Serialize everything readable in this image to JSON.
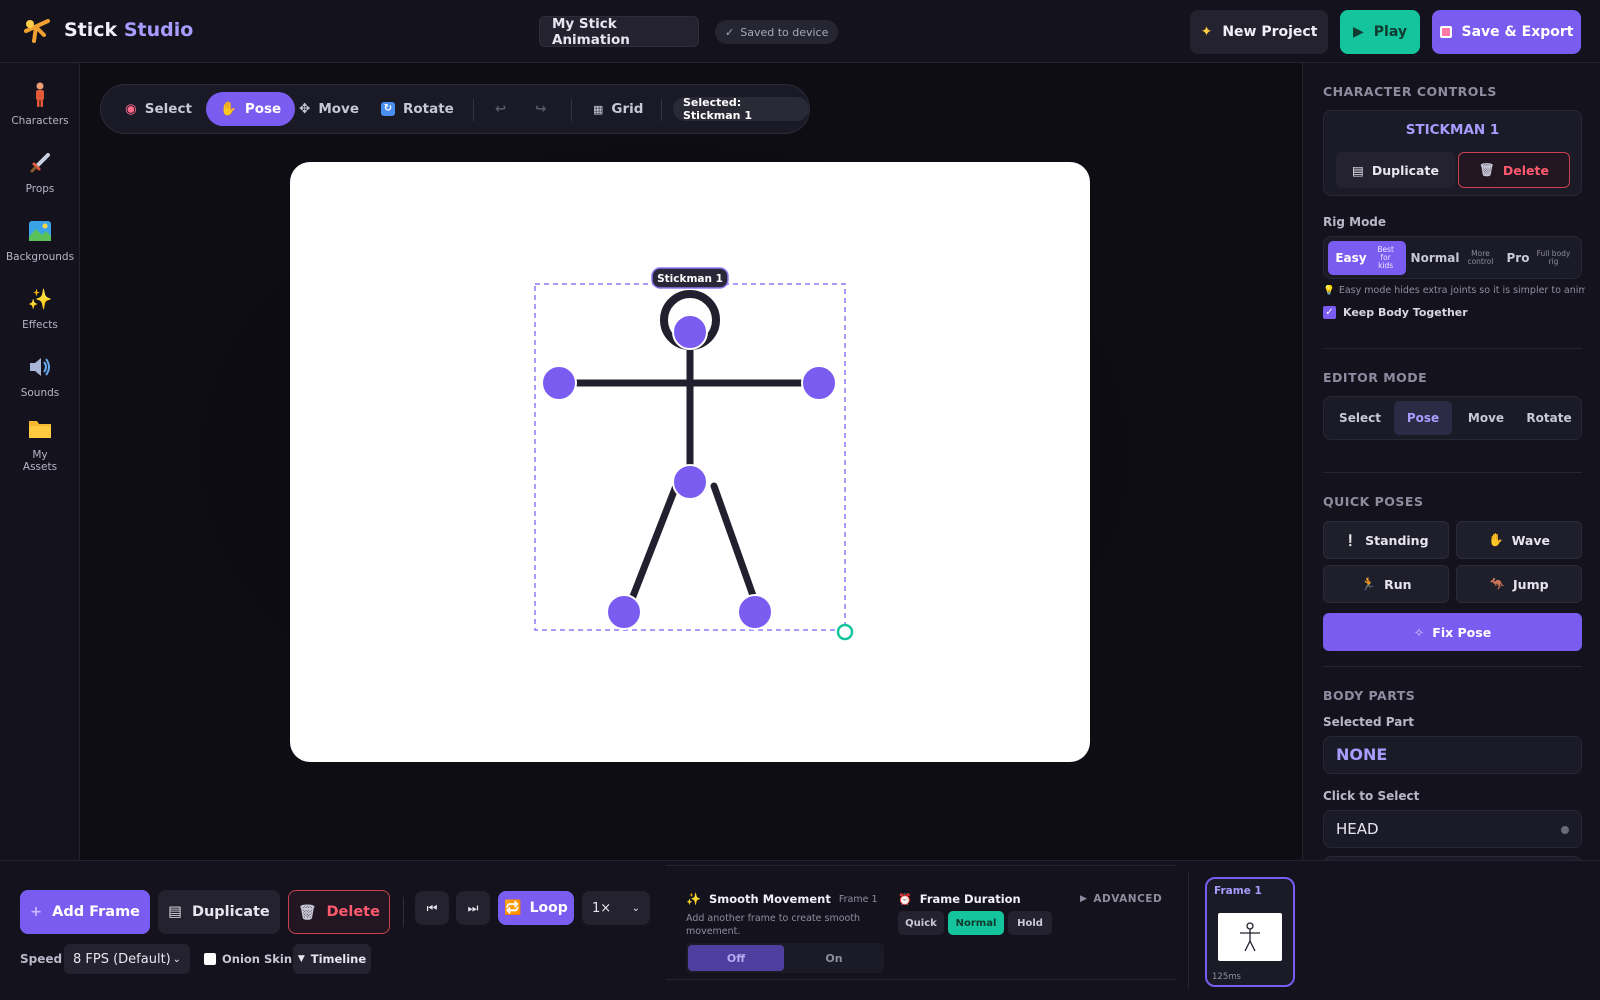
{
  "header": {
    "brand_part1": "Stick",
    "brand_part2": "Studio",
    "project_title": "My Stick Animation",
    "saved_status": "Saved to device",
    "new_project_label": "New Project",
    "play_label": "Play",
    "save_export_label": "Save & Export"
  },
  "sidebar": {
    "items": [
      {
        "label": "Characters",
        "icon": "person-icon"
      },
      {
        "label": "Props",
        "icon": "sword-icon"
      },
      {
        "label": "Backgrounds",
        "icon": "landscape-icon"
      },
      {
        "label": "Effects",
        "icon": "sparkles-icon"
      },
      {
        "label": "Sounds",
        "icon": "speaker-icon"
      },
      {
        "label_line1": "My",
        "label_line2": "Assets",
        "icon": "folder-icon"
      }
    ]
  },
  "toolbar": {
    "select_label": "Select",
    "pose_label": "Pose",
    "move_label": "Move",
    "rotate_label": "Rotate",
    "grid_label": "Grid",
    "selected_badge": "Selected: Stickman 1",
    "active_tool": "Pose"
  },
  "canvas": {
    "character_label": "Stickman 1",
    "colors": {
      "joint": "#7a5cf0",
      "bone": "#22202e",
      "selection": "#8b7cf6",
      "handle": "#14c49c"
    }
  },
  "right_panel": {
    "character_controls_title": "CHARACTER CONTROLS",
    "character_name": "STICKMAN 1",
    "duplicate_label": "Duplicate",
    "delete_label": "Delete",
    "rig_mode_label": "Rig Mode",
    "rig_modes": [
      {
        "name": "Easy",
        "hint": "Best for kids"
      },
      {
        "name": "Normal",
        "hint": "More control"
      },
      {
        "name": "Pro",
        "hint": "Full body rig"
      }
    ],
    "rig_mode_selected": "Easy",
    "rig_hint": "Easy mode hides extra joints so it is simpler to animate.",
    "keep_body_together_label": "Keep Body Together",
    "keep_body_together": true,
    "editor_mode_title": "EDITOR MODE",
    "editor_modes": [
      "Select",
      "Pose",
      "Move",
      "Rotate"
    ],
    "editor_mode_selected": "Pose",
    "quick_poses_title": "QUICK POSES",
    "quick_poses": [
      "Standing",
      "Wave",
      "Run",
      "Jump"
    ],
    "fix_pose_label": "Fix Pose",
    "body_parts_title": "BODY PARTS",
    "selected_part_label": "Selected Part",
    "selected_part_value": "NONE",
    "click_to_select_label": "Click to Select",
    "parts": [
      "HEAD"
    ]
  },
  "bottom_bar": {
    "add_frame_label": "Add Frame",
    "duplicate_label": "Duplicate",
    "delete_label": "Delete",
    "loop_label": "Loop",
    "playback_speed": "1×",
    "speed_label": "Speed",
    "fps_value": "8 FPS (Default)",
    "onion_skin_label": "Onion Skin",
    "onion_skin": false,
    "timeline_label": "Timeline",
    "smooth_movement_title": "Smooth Movement",
    "smooth_movement_frame": "Frame 1",
    "smooth_movement_desc": "Add another frame to create smooth movement.",
    "off_label": "Off",
    "on_label": "On",
    "frame_duration_title": "Frame Duration",
    "durations": [
      "Quick",
      "Normal",
      "Hold"
    ],
    "duration_selected": "Normal",
    "advanced_label": "ADVANCED",
    "frames": [
      {
        "label": "Frame 1",
        "duration": "125ms"
      }
    ]
  }
}
